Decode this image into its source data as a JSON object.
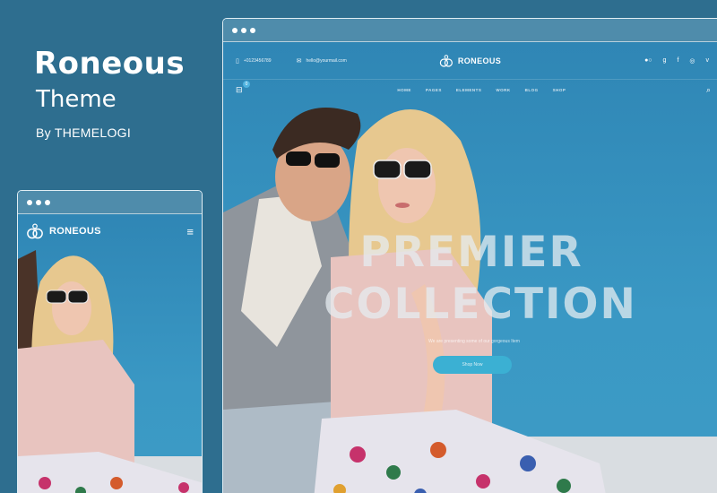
{
  "promo": {
    "title": "Roneous",
    "subtitle": "Theme",
    "byline": "By THEMELOGI"
  },
  "desktop": {
    "topbar": {
      "phone": "+0123456789",
      "email": "hello@yourmail.com",
      "brand": "RONEOUS",
      "socials": [
        "flickr-icon",
        "google-plus-icon",
        "facebook-icon",
        "dribbble-icon",
        "vimeo-icon"
      ]
    },
    "nav": {
      "cart_count": "0",
      "items": [
        "HOME",
        "PAGES",
        "ELEMENTS",
        "WORK",
        "BLOG",
        "SHOP"
      ]
    },
    "hero": {
      "title_line1": "PREMIER",
      "title_line2": "COLLECTION",
      "subtitle": "We are presenting some of our gorgeous Item",
      "button": "Shop Now"
    }
  },
  "mobile": {
    "brand": "RONEOUS"
  },
  "colors": {
    "background": "#2e6e8f",
    "accent": "#3bb0d3",
    "photo_bg": "#3a98c4"
  }
}
